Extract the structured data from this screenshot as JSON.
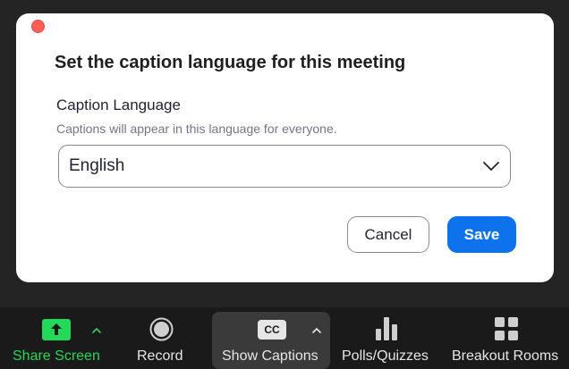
{
  "dialog": {
    "title": "Set the caption language for this meeting",
    "field_label": "Caption Language",
    "field_hint": "Captions will appear in this language for everyone.",
    "selected_language": "English",
    "cancel_label": "Cancel",
    "save_label": "Save"
  },
  "toolbar": {
    "share_screen": "Share Screen",
    "record": "Record",
    "show_captions": "Show Captions",
    "cc_badge": "CC",
    "polls": "Polls/Quizzes",
    "breakout": "Breakout Rooms"
  },
  "icons": {
    "close": "close-dot-icon",
    "share": "share-up-arrow-icon",
    "record": "record-circle-icon",
    "captions": "cc-icon",
    "polls": "bar-chart-icon",
    "breakout": "grid-icon",
    "chevron": "chevron-down-icon",
    "caret": "caret-up-icon"
  },
  "colors": {
    "accent_blue": "#0e72ed",
    "share_green": "#23d959",
    "close_red": "#ff5f57",
    "toolbar_bg": "#1a1a1a"
  }
}
